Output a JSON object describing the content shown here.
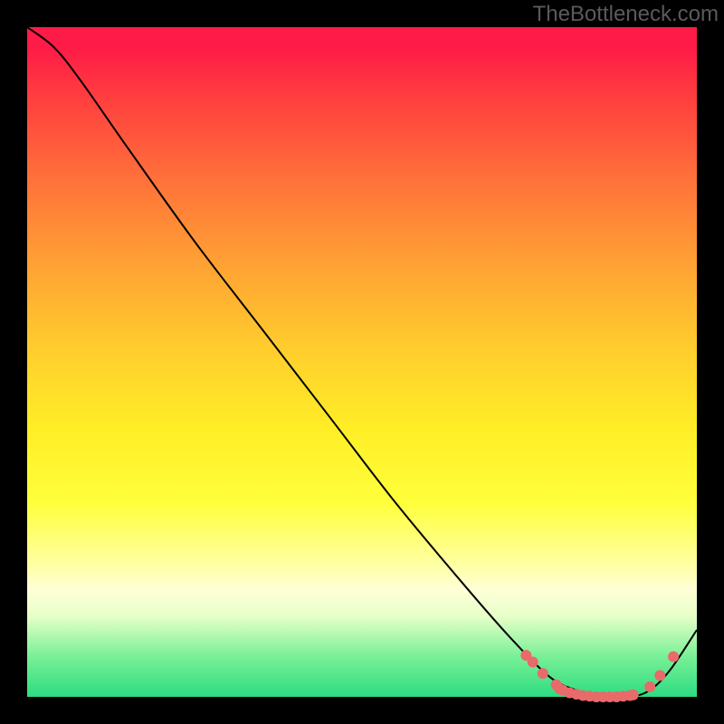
{
  "watermark": "TheBottleneck.com",
  "chart_data": {
    "type": "line",
    "title": "",
    "xlabel": "",
    "ylabel": "",
    "xlim": [
      0,
      1
    ],
    "ylim": [
      0,
      1
    ],
    "x": [
      0.0,
      0.04,
      0.08,
      0.15,
      0.25,
      0.35,
      0.45,
      0.55,
      0.65,
      0.72,
      0.78,
      0.82,
      0.86,
      0.9,
      0.93,
      0.96,
      1.0
    ],
    "y": [
      1.0,
      0.97,
      0.92,
      0.82,
      0.68,
      0.55,
      0.42,
      0.29,
      0.17,
      0.09,
      0.03,
      0.01,
      0.0,
      0.0,
      0.01,
      0.04,
      0.1
    ],
    "markers": {
      "x": [
        0.745,
        0.755,
        0.77,
        0.79,
        0.795,
        0.8,
        0.81,
        0.82,
        0.83,
        0.84,
        0.85,
        0.86,
        0.87,
        0.88,
        0.89,
        0.9,
        0.905,
        0.93,
        0.945,
        0.965
      ],
      "y": [
        0.062,
        0.052,
        0.035,
        0.018,
        0.012,
        0.01,
        0.006,
        0.004,
        0.002,
        0.001,
        0.0,
        0.0,
        0.0,
        0.0,
        0.001,
        0.002,
        0.003,
        0.015,
        0.032,
        0.06
      ],
      "color": "#e86a6a",
      "radius": 6
    },
    "line_color": "#000000",
    "line_width": 2
  }
}
